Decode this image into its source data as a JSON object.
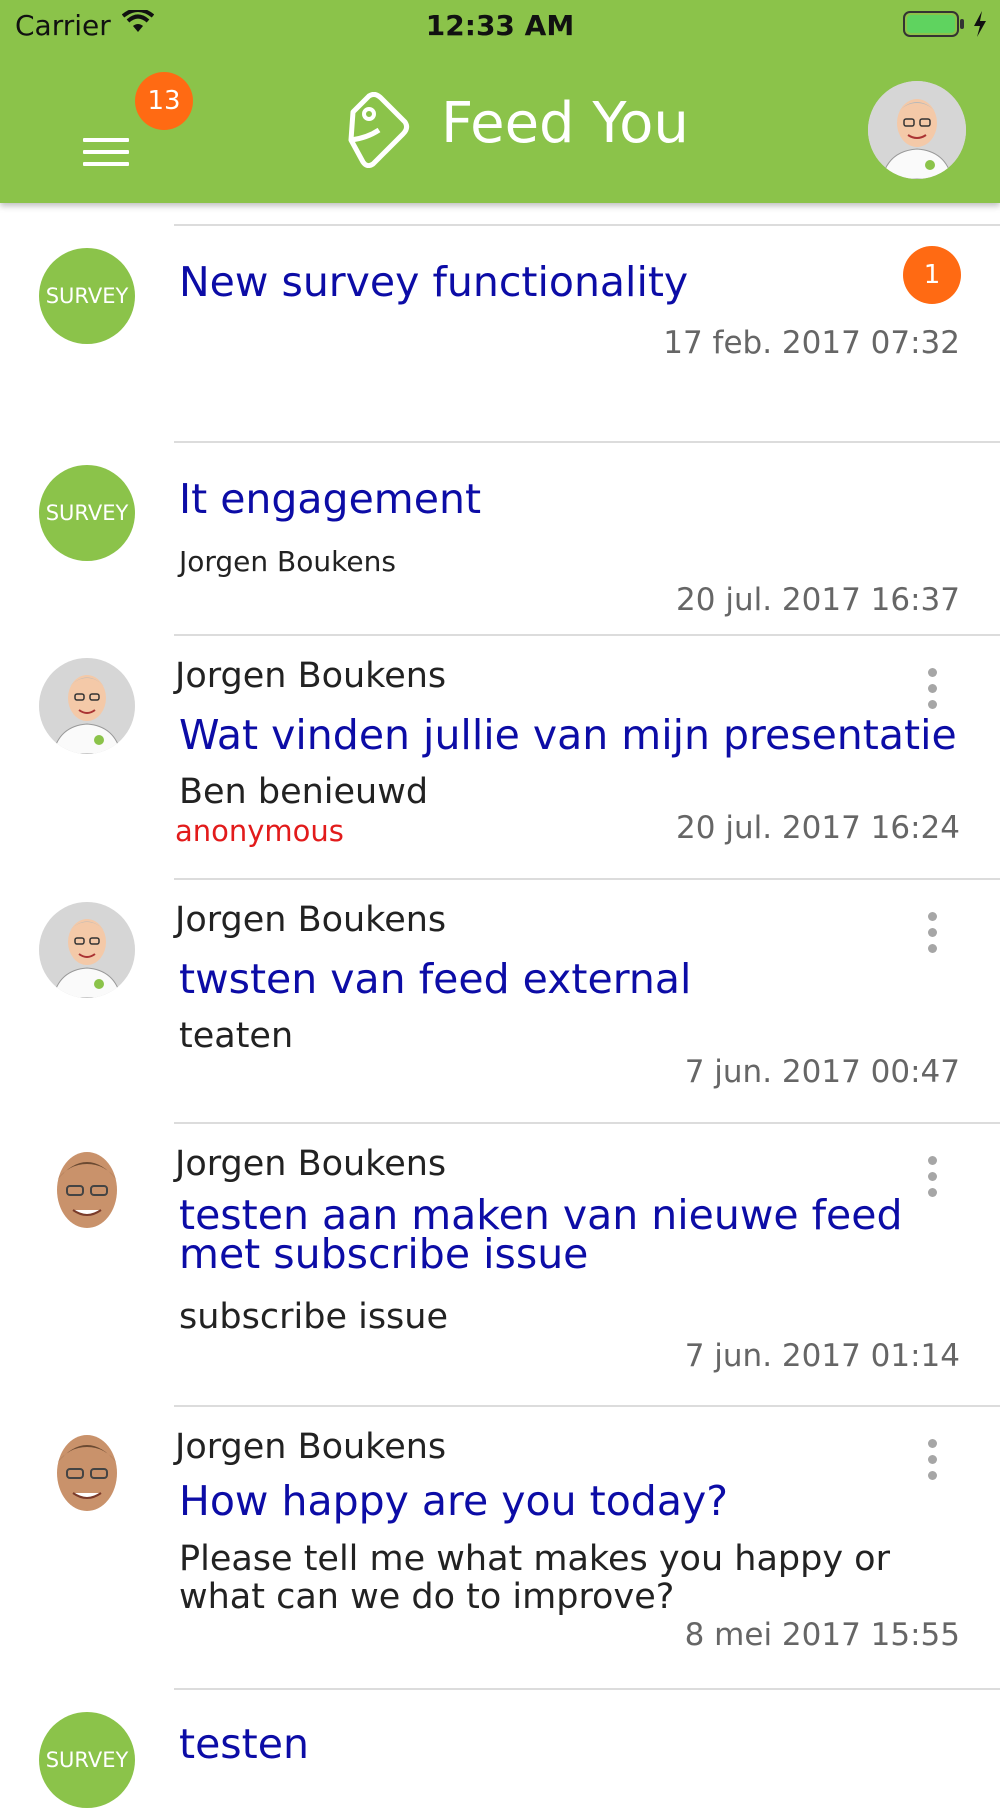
{
  "status_bar": {
    "carrier": "Carrier",
    "time": "12:33 AM"
  },
  "header": {
    "menu_badge": "13",
    "title": "Feed You"
  },
  "colors": {
    "brand": "#8bc34a",
    "badge": "#ff6a13",
    "title_link": "#0c0ca6",
    "anonymous": "#e21b1b"
  },
  "feed": [
    {
      "type": "survey",
      "icon_label": "SURVEY",
      "title": "New survey functionality",
      "badge": "1",
      "date": "17 feb. 2017 07:32"
    },
    {
      "type": "survey",
      "icon_label": "SURVEY",
      "title": "It engagement",
      "author": "Jorgen Boukens",
      "date": "20 jul. 2017 16:37"
    },
    {
      "type": "post",
      "author": "Jorgen Boukens",
      "title": "Wat vinden jullie van mijn presentatie",
      "text": "Ben benieuwd",
      "tag": "anonymous",
      "date": "20 jul. 2017 16:24"
    },
    {
      "type": "post",
      "author": "Jorgen Boukens",
      "title": "twsten van feed external",
      "text": "teaten",
      "date": "7 jun. 2017 00:47"
    },
    {
      "type": "post",
      "author": "Jorgen Boukens",
      "title": "testen aan maken van nieuwe feed met subscribe issue",
      "text": "subscribe issue",
      "date": "7 jun. 2017 01:14"
    },
    {
      "type": "post",
      "author": "Jorgen Boukens",
      "title": "How happy are you today?",
      "text": "Please tell me what makes you happy or what can we do to improve?",
      "date": "8 mei 2017 15:55"
    },
    {
      "type": "survey",
      "icon_label": "SURVEY",
      "title": "testen"
    }
  ]
}
